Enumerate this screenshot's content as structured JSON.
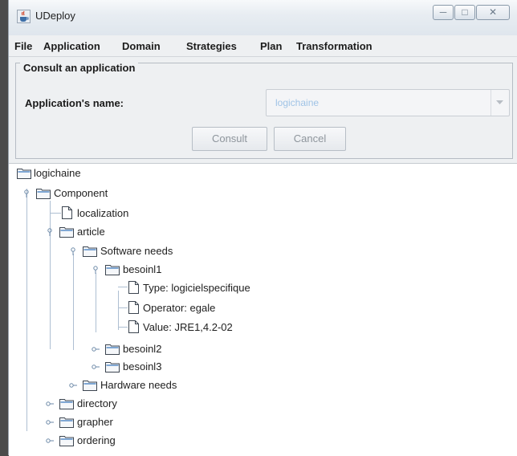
{
  "window": {
    "title": "UDeploy",
    "icon": "java-cup-icon",
    "controls": [
      "minimize",
      "maximize",
      "close"
    ]
  },
  "menubar": {
    "items": [
      "File",
      "Application",
      "Domain",
      "Strategies",
      "Plan",
      "Transformation"
    ]
  },
  "consult_panel": {
    "legend": "Consult an application",
    "field_label": "Application's name:",
    "selected_value": "logichaine",
    "consult_label": "Consult",
    "cancel_label": "Cancel"
  },
  "tree": {
    "root": "logichaine",
    "component": "Component",
    "localization": "localization",
    "article": "article",
    "software_needs": "Software needs",
    "besoin1": "besoinl1",
    "type": "Type: logicielspecifique",
    "operator": "Operator: egale",
    "value": "Value: JRE1,4.2-02",
    "besoin2": "besoinl2",
    "besoin3": "besoinl3",
    "hardware_needs": "Hardware needs",
    "directory": "directory",
    "grapher": "grapher",
    "ordering": "ordering"
  },
  "colors": {
    "accent": "#2f6fb4",
    "tree_line": "#aebfd2",
    "disabled_text": "#9fc3e6"
  }
}
